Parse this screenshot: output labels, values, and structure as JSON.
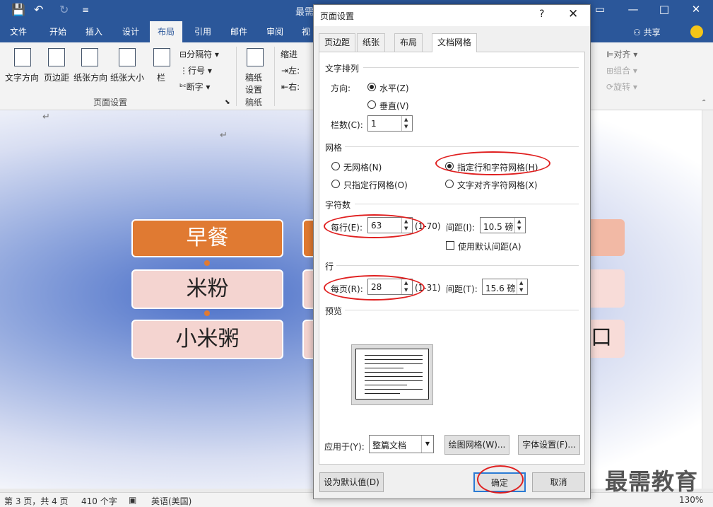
{
  "titlebar": {
    "title": "最需",
    "qa_save": "💾",
    "qa_undo": "↶",
    "qa_redo": "↻",
    "qa_more": "≡",
    "btn_help": "?",
    "btn_restore": "▭",
    "btn_min": "—",
    "btn_max": "□",
    "btn_close": "✕"
  },
  "tabs": [
    "文件",
    "开始",
    "插入",
    "设计",
    "布局",
    "引用",
    "邮件",
    "审阅",
    "视"
  ],
  "share": "共享",
  "ribbon": {
    "buttons": [
      "文字方向",
      "页边距",
      "纸张方向",
      "纸张大小",
      "栏"
    ],
    "small_items": [
      "分隔符",
      "行号",
      "断字"
    ],
    "group_page_setup": "页面设置",
    "manuscript_button": [
      "稿纸",
      "设置"
    ],
    "group_manuscript": "稿纸",
    "indent": "缩进",
    "indent_left": "左:",
    "indent_right": "右:",
    "arrange_items": [
      "对齐",
      "组合",
      "旋转"
    ]
  },
  "document": {
    "boxes": [
      "早餐",
      "米粉",
      "小米粥"
    ],
    "right_partial": "口"
  },
  "statusbar": {
    "page": "第 3 页，共 4 页",
    "words": "410 个字",
    "language": "英语(美国)",
    "zoom": "130%"
  },
  "watermark": "最需教育",
  "dialog": {
    "title": "页面设置",
    "help": "?",
    "close": "✕",
    "tabs": [
      "页边距",
      "纸张",
      "布局",
      "文档网格"
    ],
    "text_direction": {
      "heading": "文字排列",
      "direction_label": "方向:",
      "horizontal": "水平(Z)",
      "vertical": "垂直(V)",
      "columns_label": "栏数(C):",
      "columns_value": "1"
    },
    "grid": {
      "heading": "网格",
      "no_grid": "无网格(N)",
      "line_and_char": "指定行和字符网格(H)",
      "line_only": "只指定行网格(O)",
      "snap_chars": "文字对齐字符网格(X)"
    },
    "characters": {
      "heading": "字符数",
      "per_line_label": "每行(E):",
      "per_line_value": "63",
      "range": "(1-70)",
      "pitch_label": "间距(I):",
      "pitch_value": "10.5 磅",
      "default_pitch": "使用默认间距(A)"
    },
    "lines": {
      "heading": "行",
      "per_page_label": "每页(R):",
      "per_page_value": "28",
      "range": "(1-31)",
      "pitch_label": "间距(T):",
      "pitch_value": "15.6 磅"
    },
    "preview_heading": "预览",
    "apply_to_label": "应用于(Y):",
    "apply_to_value": "整篇文档",
    "draw_grid_button": "绘图网格(W)...",
    "font_settings_button": "字体设置(F)...",
    "set_default_button": "设为默认值(D)",
    "ok_button": "确定",
    "cancel_button": "取消"
  }
}
